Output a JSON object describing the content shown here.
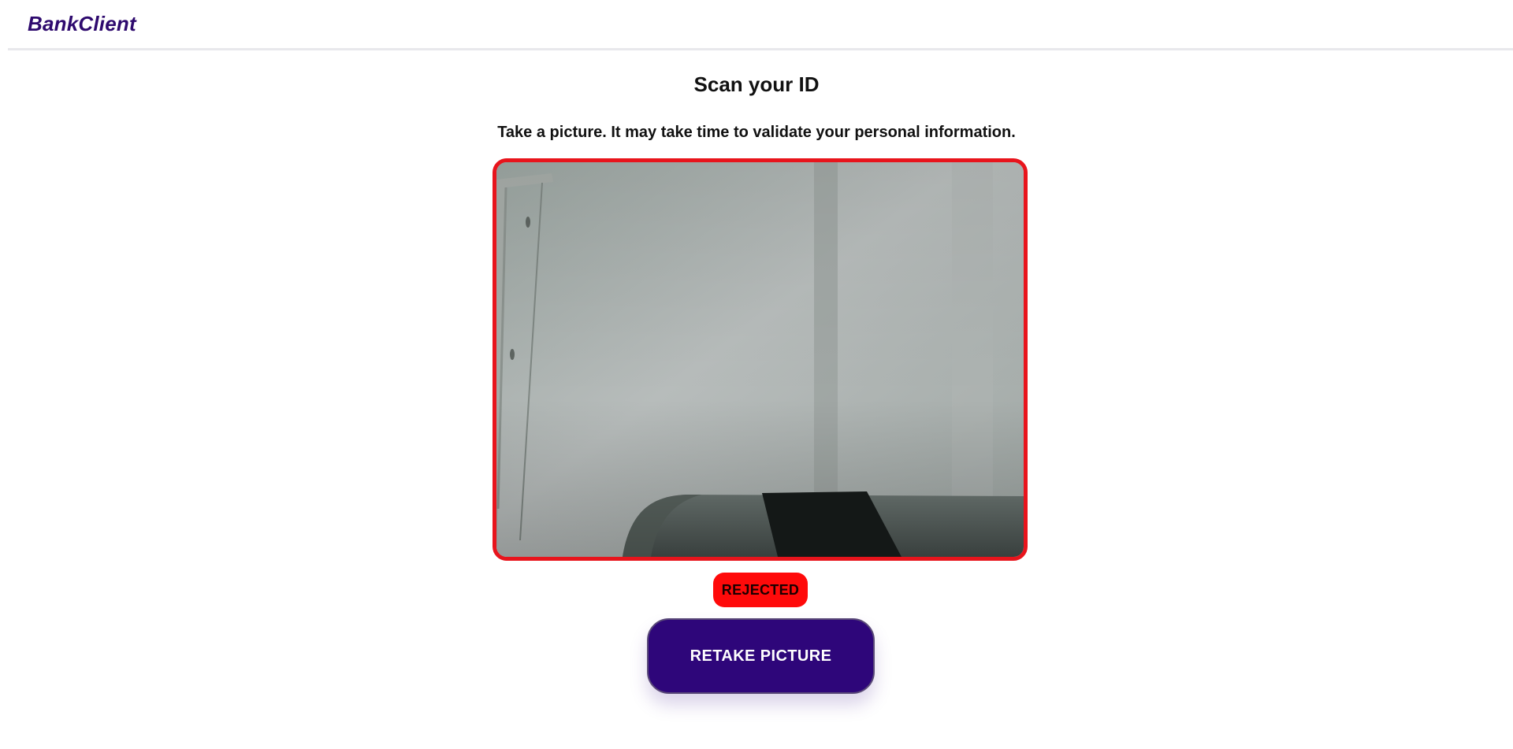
{
  "header": {
    "brand": "BankClient"
  },
  "main": {
    "title": "Scan your ID",
    "instructions": "Take a picture. It may take time to validate your personal information.",
    "camera_preview": {
      "status": "REJECTED"
    },
    "retake_label": "RETAKE PICTURE"
  },
  "colors": {
    "brand": "#2e0a6e",
    "rejected": "#ff0a0a",
    "frame_border": "#e8141c",
    "primary_button": "#2e067a"
  }
}
